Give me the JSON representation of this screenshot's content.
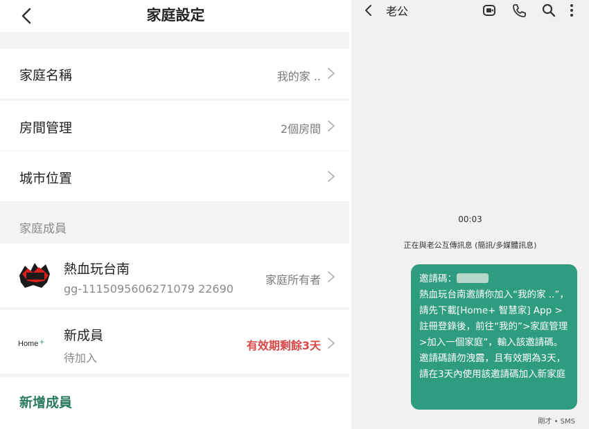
{
  "settings": {
    "title": "家庭設定",
    "rows": [
      {
        "label": "家庭名稱",
        "value": "我的家 .."
      },
      {
        "label": "房間管理",
        "value": "2個房間"
      },
      {
        "label": "城市位置",
        "value": ""
      }
    ],
    "members_section_title": "家庭成員",
    "members": [
      {
        "name": "熱血玩台南",
        "sub": "gg-1115095606271079 22690",
        "role": "家庭所有者"
      },
      {
        "name": "新成員",
        "sub": "待加入",
        "expiry": "有效期剩餘3天"
      }
    ],
    "new_member_logo": "Home+",
    "add_member_label": "新增成員"
  },
  "chat": {
    "contact": "老公",
    "call_timer": "00:03",
    "conversation_label": "正在與老公互傳訊息 (簡訊/多媒體訊息)",
    "message_lines": [
      "邀請碼：",
      "熱血玩台南邀請你加入“我的家 ..”，請先下載[Home+ 智慧家] App >註冊登錄後，前往“我的”>家庭管理>加入一個家庭”，輸入該邀請碼。",
      "邀請碼請勿洩露，且有效期為3天，請在3天內使用該邀請碼加入新家庭"
    ],
    "message_meta": "剛才 • SMS",
    "colors": {
      "bubble": "#2e9c7e",
      "expiry": "#d94747",
      "add_member": "#2a7a62"
    }
  }
}
